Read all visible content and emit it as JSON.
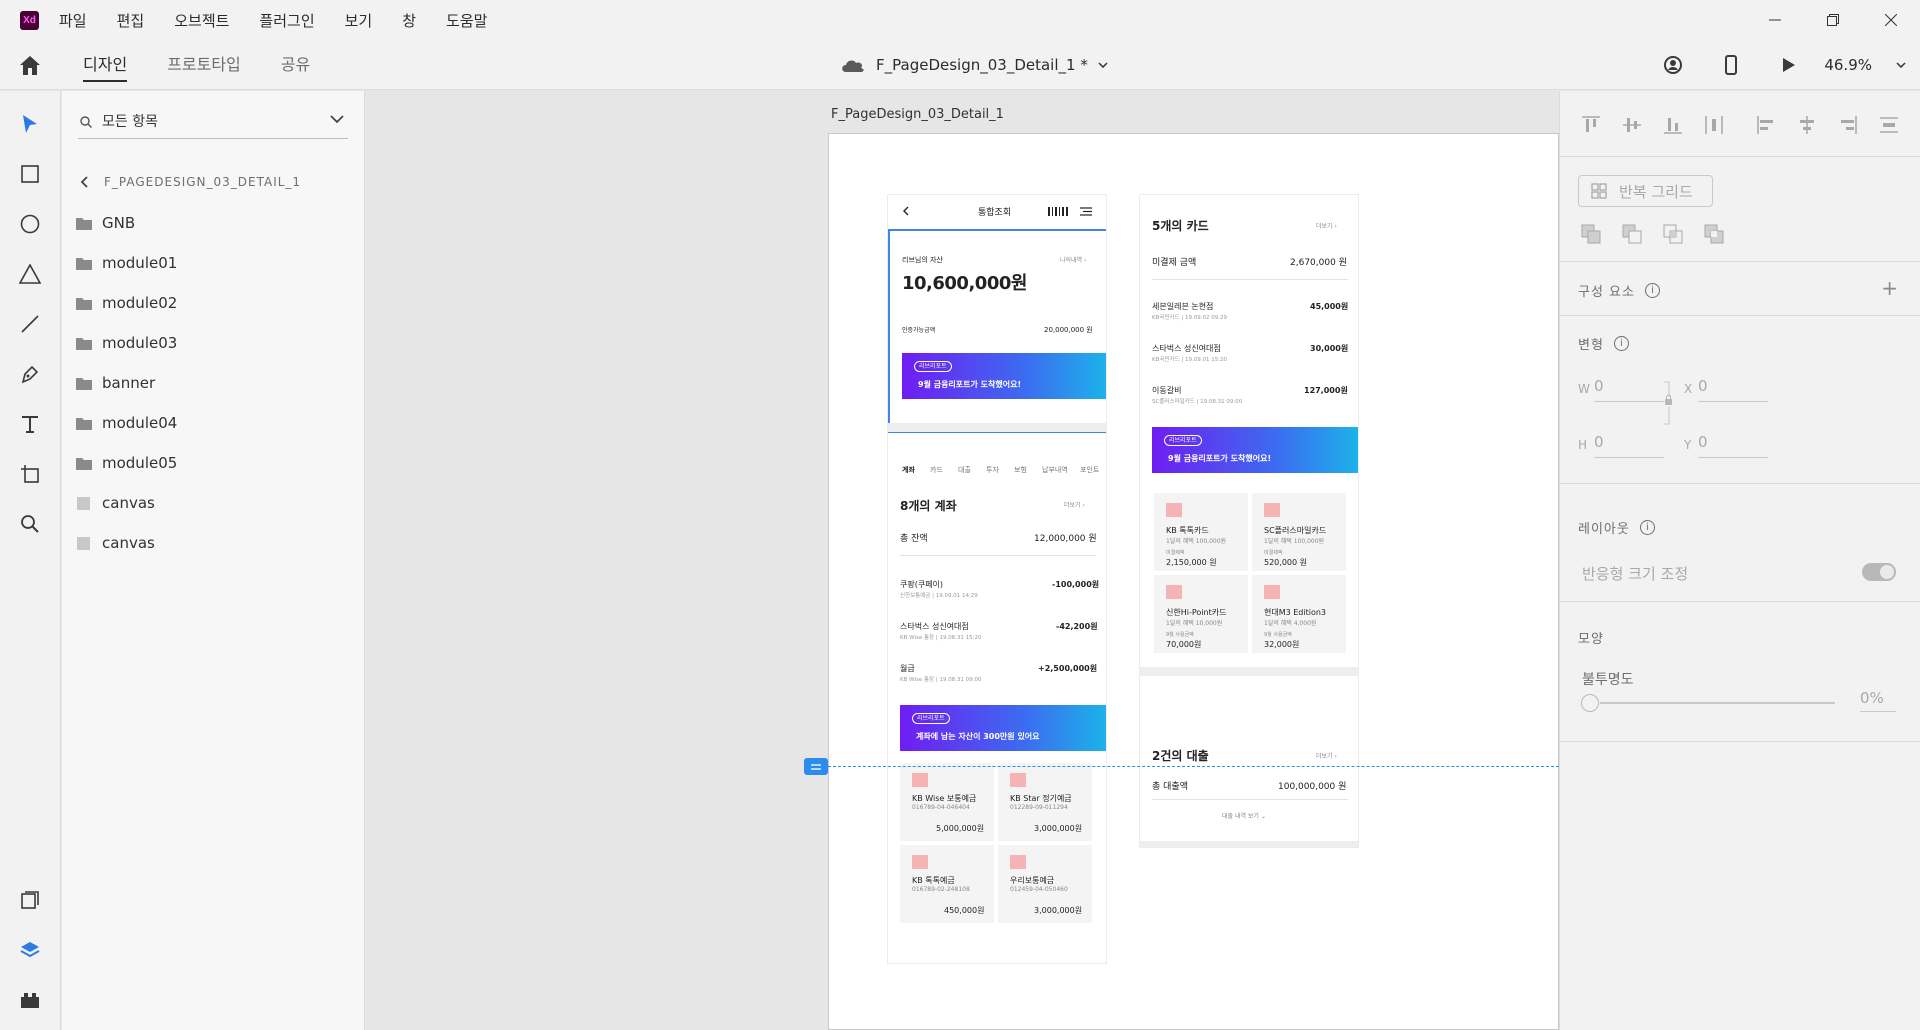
{
  "menu": {
    "logo": "Xd",
    "items": [
      "파일",
      "편집",
      "오브젝트",
      "플러그인",
      "보기",
      "창",
      "도움말"
    ]
  },
  "tabs": [
    "디자인",
    "프로토타입",
    "공유"
  ],
  "document": {
    "title": "F_PageDesign_03_Detail_1 *"
  },
  "toolbar": {
    "zoom": "46.9%"
  },
  "layers": {
    "search_placeholder": "모든 항목",
    "breadcrumb": "F_PAGEDESIGN_03_DETAIL_1",
    "items": [
      {
        "name": "GNB",
        "type": "folder"
      },
      {
        "name": "module01",
        "type": "folder"
      },
      {
        "name": "module02",
        "type": "folder"
      },
      {
        "name": "module03",
        "type": "folder"
      },
      {
        "name": "banner",
        "type": "folder"
      },
      {
        "name": "module04",
        "type": "folder"
      },
      {
        "name": "module05",
        "type": "folder"
      },
      {
        "name": "canvas",
        "type": "rect"
      },
      {
        "name": "canvas",
        "type": "rect"
      }
    ]
  },
  "artboard": {
    "title": "F_PageDesign_03_Detail_1"
  },
  "screen1": {
    "header_title": "통합조회",
    "asset_label": "리브님의 자산",
    "asset_link": "나의내역 ›",
    "asset_amount": "10,600,000원",
    "credit_label": "인증가능금액",
    "credit_value": "20,000,000 원",
    "promo1_badge": "리브리포트",
    "promo1_text": "9월 금융리포트가 도착했어요!",
    "subtabs": [
      "계좌",
      "카드",
      "대출",
      "투자",
      "보험",
      "납부내역",
      "포인트"
    ],
    "accounts_title": "8개의 계좌",
    "more": "더보기 ›",
    "balance_label": "총 잔액",
    "balance_value": "12,000,000 원",
    "tx": [
      {
        "name": "쿠팡(쿠페이)",
        "sub": "신한보통예금 | 19.09.01 14:29",
        "amount": "-100,000원"
      },
      {
        "name": "스타벅스 성신여대점",
        "sub": "KB Wise 통장 | 19.08.31 15:20",
        "amount": "-42,200원"
      },
      {
        "name": "월급",
        "sub": "KB Wise 통장 | 19.08.31 09:00",
        "amount": "+2,500,000원"
      }
    ],
    "promo2_badge": "리브리포트",
    "promo2_text": "계좌에 남는 자산이 300만원 있어요",
    "tiles": [
      {
        "name": "KB Wise 보통예금",
        "num": "016789-04-046404",
        "amount": "5,000,000원"
      },
      {
        "name": "KB Star 정기예금",
        "num": "012289-09-011294",
        "amount": "3,000,000원"
      },
      {
        "name": "KB 톡톡예금",
        "num": "016789-02-248108",
        "amount": "450,000원"
      },
      {
        "name": "우리보통예금",
        "num": "012459-04-050460",
        "amount": "3,000,000원"
      }
    ]
  },
  "screen2": {
    "cards_title": "5개의 카드",
    "more": "더보기 ›",
    "unpaid_label": "미결제 금액",
    "unpaid_value": "2,670,000 원",
    "tx": [
      {
        "name": "세븐일레븐 논현점",
        "sub": "KB국민카드 | 19.09.02 09:29",
        "amount": "45,000원"
      },
      {
        "name": "스타벅스 성신여대점",
        "sub": "KB국민카드 | 19.09.01 15:20",
        "amount": "30,000원"
      },
      {
        "name": "이동갈비",
        "sub": "SC플러스마일카드 | 19.08.31 09:00",
        "amount": "127,000원"
      }
    ],
    "promo_badge": "리브리포트",
    "promo_text": "9월 금융리포트가 도착했어요!",
    "tiles": [
      {
        "name": "KB 톡톡카드",
        "benefit": "1달의 혜택 100,000원",
        "label": "미결제액",
        "amount": "2,150,000 원"
      },
      {
        "name": "SC플러스마일카드",
        "benefit": "1달의 혜택 100,000원",
        "label": "미결제액",
        "amount": "520,000 원"
      },
      {
        "name": "신한Hi-Point카드",
        "benefit": "1달의 혜택 10,000원",
        "label": "9월 사용금액",
        "amount": "70,000원"
      },
      {
        "name": "현대M3 Edition3",
        "benefit": "1달의 혜택 4,000원",
        "label": "9월 사용금액",
        "amount": "32,000원"
      }
    ],
    "loans_title": "2건의 대출",
    "loan_label": "총 대출액",
    "loan_value": "100,000,000 원",
    "loan_link": "대출 내역 보기 ⌄"
  },
  "props": {
    "repeat_grid": "반복 그리드",
    "components": "구성 요소",
    "transform": "변형",
    "w_label": "W",
    "w_value": "0",
    "x_label": "X",
    "x_value": "0",
    "h_label": "H",
    "h_value": "0",
    "y_label": "Y",
    "y_value": "0",
    "layout": "레이아웃",
    "responsive": "반응형 크기 조정",
    "appearance": "모양",
    "opacity_label": "불투명도",
    "opacity_value": "0%"
  },
  "colors": {
    "selection": "#3b86e8",
    "guide": "#2d8ceb",
    "promo_start": "#6f1df2",
    "promo_end": "#1cb4ea"
  }
}
